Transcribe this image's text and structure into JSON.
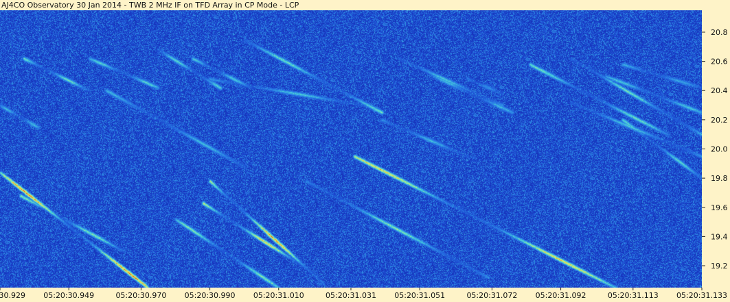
{
  "title": "AJ4CO Observatory 30 Jan 2014 - TWB 2 MHz IF on TFD Array in CP Mode - LCP",
  "chart_data": {
    "type": "heatmap",
    "y_ticks": [
      "19.2",
      "19.4",
      "19.6",
      "19.8",
      "20.0",
      "20.2",
      "20.4",
      "20.6",
      "20.8"
    ],
    "y_tick_values": [
      19.2,
      19.4,
      19.6,
      19.8,
      20.0,
      20.2,
      20.4,
      20.6,
      20.8
    ],
    "ylim": [
      19.05,
      20.95
    ],
    "x_ticks": [
      "05:20:30.929",
      "05:20:30.949",
      "05:20:30.970",
      "05:20:30.990",
      "05:20:31.010",
      "05:20:31.031",
      "05:20:31.051",
      "05:20:31.072",
      "05:20:31.092",
      "05:20:31.113",
      "05:20:31.133"
    ],
    "x_tick_values": [
      30.929,
      30.949,
      30.97,
      30.99,
      31.01,
      31.031,
      31.051,
      31.072,
      31.092,
      31.113,
      31.133
    ],
    "xlim": [
      30.929,
      31.133
    ],
    "colors": {
      "background": "#1f47c6",
      "bright": "#e8f27a",
      "hot": "#d8402a",
      "axis_bg": "#fef3c8"
    },
    "bursts": [
      {
        "x0": 30.929,
        "y0": 19.84,
        "x1": 30.972,
        "y1": 19.05,
        "intensity": 1.0
      },
      {
        "x0": 30.935,
        "y0": 19.68,
        "x1": 30.965,
        "y1": 19.3,
        "intensity": 0.6
      },
      {
        "x0": 30.99,
        "y0": 19.78,
        "x1": 31.023,
        "y1": 19.08,
        "intensity": 0.95
      },
      {
        "x0": 30.988,
        "y0": 19.63,
        "x1": 31.017,
        "y1": 19.2,
        "intensity": 0.85
      },
      {
        "x0": 30.98,
        "y0": 19.52,
        "x1": 31.01,
        "y1": 19.05,
        "intensity": 0.6
      },
      {
        "x0": 31.032,
        "y0": 19.95,
        "x1": 31.108,
        "y1": 19.05,
        "intensity": 0.85
      },
      {
        "x0": 31.018,
        "y0": 19.78,
        "x1": 31.071,
        "y1": 19.12,
        "intensity": 0.6
      },
      {
        "x0": 30.96,
        "y0": 20.4,
        "x1": 31.0,
        "y1": 19.88,
        "intensity": 0.4
      },
      {
        "x0": 31.04,
        "y0": 20.2,
        "x1": 31.065,
        "y1": 19.95,
        "intensity": 0.4
      },
      {
        "x0": 31.0,
        "y0": 20.75,
        "x1": 31.04,
        "y1": 20.25,
        "intensity": 0.55
      },
      {
        "x0": 30.99,
        "y0": 20.48,
        "x1": 31.035,
        "y1": 20.3,
        "intensity": 0.45
      },
      {
        "x0": 31.045,
        "y0": 20.62,
        "x1": 31.075,
        "y1": 20.3,
        "intensity": 0.45
      },
      {
        "x0": 31.055,
        "y0": 20.5,
        "x1": 31.078,
        "y1": 20.25,
        "intensity": 0.4
      },
      {
        "x0": 30.936,
        "y0": 20.62,
        "x1": 30.955,
        "y1": 20.4,
        "intensity": 0.55
      },
      {
        "x0": 30.955,
        "y0": 20.62,
        "x1": 30.975,
        "y1": 20.42,
        "intensity": 0.5
      },
      {
        "x0": 30.975,
        "y0": 20.68,
        "x1": 30.993,
        "y1": 20.42,
        "intensity": 0.5
      },
      {
        "x0": 30.985,
        "y0": 20.62,
        "x1": 31.002,
        "y1": 20.42,
        "intensity": 0.45
      },
      {
        "x0": 31.083,
        "y0": 20.58,
        "x1": 31.123,
        "y1": 20.1,
        "intensity": 0.55
      },
      {
        "x0": 31.095,
        "y0": 20.62,
        "x1": 31.133,
        "y1": 20.1,
        "intensity": 0.55
      },
      {
        "x0": 31.105,
        "y0": 20.5,
        "x1": 31.133,
        "y1": 20.25,
        "intensity": 0.45
      },
      {
        "x0": 31.11,
        "y0": 20.58,
        "x1": 31.133,
        "y1": 20.42,
        "intensity": 0.35
      },
      {
        "x0": 31.11,
        "y0": 20.2,
        "x1": 31.133,
        "y1": 19.8,
        "intensity": 0.5
      },
      {
        "x0": 31.095,
        "y0": 20.32,
        "x1": 31.133,
        "y1": 19.95,
        "intensity": 0.45
      },
      {
        "x0": 30.929,
        "y0": 20.3,
        "x1": 30.94,
        "y1": 20.15,
        "intensity": 0.4
      },
      {
        "x0": 31.065,
        "y0": 20.48,
        "x1": 31.075,
        "y1": 20.38,
        "intensity": 0.3
      }
    ]
  }
}
